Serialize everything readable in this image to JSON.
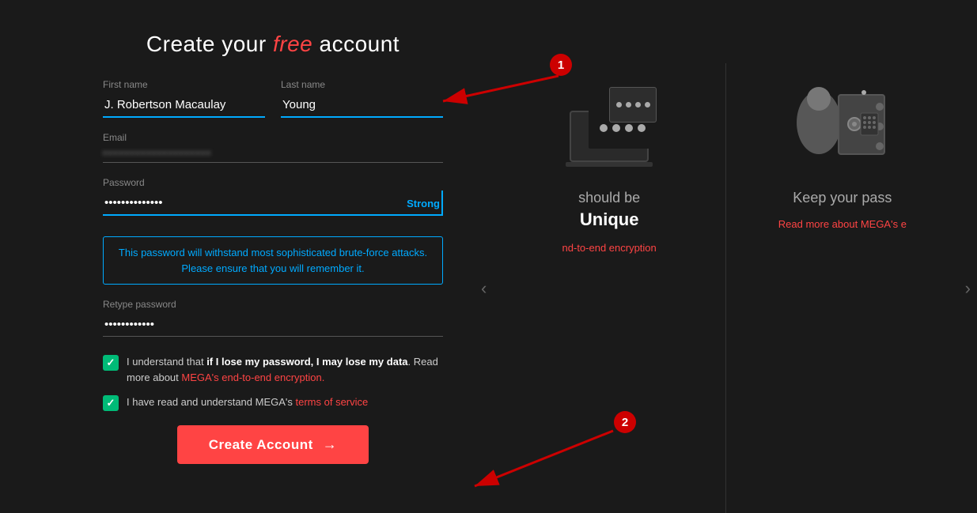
{
  "page": {
    "title_before": "Create your ",
    "title_highlight": "free",
    "title_after": " account"
  },
  "form": {
    "firstname_label": "First name",
    "firstname_value": "J. Robertson Macaulay",
    "lastname_label": "Last name",
    "lastname_value": "Young",
    "email_label": "Email",
    "email_placeholder": "••••••••••••••••••••",
    "password_label": "Password",
    "password_value": "••••••••••••••",
    "password_strength": "Strong",
    "password_hint": "This password will withstand most sophisticated brute-force attacks. Please ensure that you will remember it.",
    "retype_label": "Retype password",
    "retype_value": "••••••••••••",
    "checkbox1_text_normal": "I understand that ",
    "checkbox1_text_bold": "if I lose my password, I may lose my data",
    "checkbox1_text_normal2": ". Read more about ",
    "checkbox1_link": "MEGA's end-to-end encryption.",
    "checkbox2_text_normal": "I have read and understand MEGA's ",
    "checkbox2_link": "terms of service",
    "create_btn": "Create Account"
  },
  "carousel": {
    "slide1": {
      "subtitle": "should be",
      "title": "Unique",
      "link": "nd-to-end encryption"
    },
    "slide2": {
      "title": "Keep your pass",
      "link": "Read more about MEGA's e"
    }
  },
  "annotations": {
    "one": "1",
    "two": "2"
  }
}
